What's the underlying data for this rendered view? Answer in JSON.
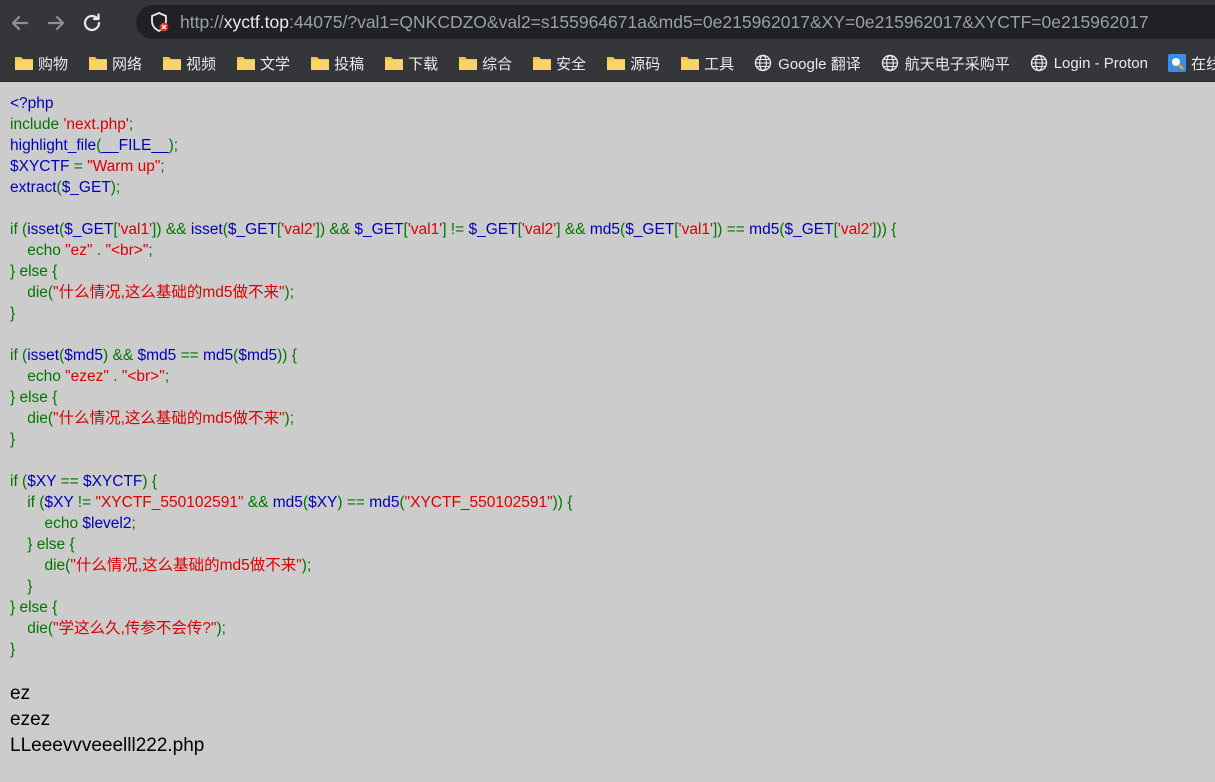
{
  "browser": {
    "url": {
      "scheme": "http://",
      "host": "xyctf.top",
      "rest": ":44075/?val1=QNKCDZO&val2=s155964671a&md5=0e215962017&XY=0e215962017&XYCTF=0e215962017"
    },
    "icons": {
      "back": "back-arrow-icon",
      "forward": "forward-arrow-icon",
      "reload": "reload-icon",
      "security": "not-secure-shield-icon"
    },
    "colors": {
      "chrome": "#35363a",
      "omnibox": "#202124",
      "folder": "#f6c343"
    }
  },
  "bookmarks": [
    {
      "label": "购物",
      "icon": "folder-icon"
    },
    {
      "label": "网络",
      "icon": "folder-icon"
    },
    {
      "label": "视频",
      "icon": "folder-icon"
    },
    {
      "label": "文学",
      "icon": "folder-icon"
    },
    {
      "label": "投稿",
      "icon": "folder-icon"
    },
    {
      "label": "下载",
      "icon": "folder-icon"
    },
    {
      "label": "综合",
      "icon": "folder-icon"
    },
    {
      "label": "安全",
      "icon": "folder-icon"
    },
    {
      "label": "源码",
      "icon": "folder-icon"
    },
    {
      "label": "工具",
      "icon": "folder-icon"
    },
    {
      "label": "Google 翻译",
      "icon": "globe-icon"
    },
    {
      "label": "航天电子采购平",
      "icon": "globe-icon"
    },
    {
      "label": "Login - Proton",
      "icon": "globe-icon"
    },
    {
      "label": "在线翻译",
      "icon": "translate-favicon-icon"
    }
  ],
  "code_lines": [
    [
      [
        "d",
        "<?php"
      ]
    ],
    [
      [
        "k",
        "include "
      ],
      [
        "s",
        "'next.php'"
      ],
      [
        "k",
        ";"
      ]
    ],
    [
      [
        "d",
        "highlight_file"
      ],
      [
        "k",
        "("
      ],
      [
        "d",
        "__FILE__"
      ],
      [
        "k",
        ");"
      ]
    ],
    [
      [
        "d",
        "$XYCTF "
      ],
      [
        "k",
        "= "
      ],
      [
        "s",
        "\"Warm up\""
      ],
      [
        "k",
        ";"
      ]
    ],
    [
      [
        "d",
        "extract"
      ],
      [
        "k",
        "("
      ],
      [
        "d",
        "$_GET"
      ],
      [
        "k",
        ");"
      ]
    ],
    [],
    [
      [
        "k",
        "if ("
      ],
      [
        "d",
        "isset"
      ],
      [
        "k",
        "("
      ],
      [
        "d",
        "$_GET"
      ],
      [
        "k",
        "["
      ],
      [
        "s",
        "'val1'"
      ],
      [
        "k",
        "]) && "
      ],
      [
        "d",
        "isset"
      ],
      [
        "k",
        "("
      ],
      [
        "d",
        "$_GET"
      ],
      [
        "k",
        "["
      ],
      [
        "s",
        "'val2'"
      ],
      [
        "k",
        "]) && "
      ],
      [
        "d",
        "$_GET"
      ],
      [
        "k",
        "["
      ],
      [
        "s",
        "'val1'"
      ],
      [
        "k",
        "] != "
      ],
      [
        "d",
        "$_GET"
      ],
      [
        "k",
        "["
      ],
      [
        "s",
        "'val2'"
      ],
      [
        "k",
        "] && "
      ],
      [
        "d",
        "md5"
      ],
      [
        "k",
        "("
      ],
      [
        "d",
        "$_GET"
      ],
      [
        "k",
        "["
      ],
      [
        "s",
        "'val1'"
      ],
      [
        "k",
        "]) == "
      ],
      [
        "d",
        "md5"
      ],
      [
        "k",
        "("
      ],
      [
        "d",
        "$_GET"
      ],
      [
        "k",
        "["
      ],
      [
        "s",
        "'val2'"
      ],
      [
        "k",
        "])) {"
      ]
    ],
    [
      [
        "k",
        "    echo "
      ],
      [
        "s",
        "\"ez\" "
      ],
      [
        "k",
        ". "
      ],
      [
        "s",
        "\"<br>\""
      ],
      [
        "k",
        ";"
      ]
    ],
    [
      [
        "k",
        "} else {"
      ]
    ],
    [
      [
        "k",
        "    die("
      ],
      [
        "s",
        "\"什么情况,这么基础的md5做不来\""
      ],
      [
        "k",
        ");"
      ]
    ],
    [
      [
        "k",
        "}"
      ]
    ],
    [],
    [
      [
        "k",
        "if ("
      ],
      [
        "d",
        "isset"
      ],
      [
        "k",
        "("
      ],
      [
        "d",
        "$md5"
      ],
      [
        "k",
        ") && "
      ],
      [
        "d",
        "$md5 "
      ],
      [
        "k",
        "== "
      ],
      [
        "d",
        "md5"
      ],
      [
        "k",
        "("
      ],
      [
        "d",
        "$md5"
      ],
      [
        "k",
        ")) {"
      ]
    ],
    [
      [
        "k",
        "    echo "
      ],
      [
        "s",
        "\"ezez\" "
      ],
      [
        "k",
        ". "
      ],
      [
        "s",
        "\"<br>\""
      ],
      [
        "k",
        ";"
      ]
    ],
    [
      [
        "k",
        "} else {"
      ]
    ],
    [
      [
        "k",
        "    die("
      ],
      [
        "s",
        "\"什么情况,这么基础的md5做不来\""
      ],
      [
        "k",
        ");"
      ]
    ],
    [
      [
        "k",
        "}"
      ]
    ],
    [],
    [
      [
        "k",
        "if ("
      ],
      [
        "d",
        "$XY "
      ],
      [
        "k",
        "== "
      ],
      [
        "d",
        "$XYCTF"
      ],
      [
        "k",
        ") {"
      ]
    ],
    [
      [
        "k",
        "    if ("
      ],
      [
        "d",
        "$XY "
      ],
      [
        "k",
        "!= "
      ],
      [
        "s",
        "\"XYCTF_550102591\" "
      ],
      [
        "k",
        "&& "
      ],
      [
        "d",
        "md5"
      ],
      [
        "k",
        "("
      ],
      [
        "d",
        "$XY"
      ],
      [
        "k",
        ") == "
      ],
      [
        "d",
        "md5"
      ],
      [
        "k",
        "("
      ],
      [
        "s",
        "\"XYCTF_550102591\""
      ],
      [
        "k",
        ")) {"
      ]
    ],
    [
      [
        "k",
        "        echo "
      ],
      [
        "d",
        "$level2"
      ],
      [
        "k",
        ";"
      ]
    ],
    [
      [
        "k",
        "    } else {"
      ]
    ],
    [
      [
        "k",
        "        die("
      ],
      [
        "s",
        "\"什么情况,这么基础的md5做不来\""
      ],
      [
        "k",
        ");"
      ]
    ],
    [
      [
        "k",
        "    }"
      ]
    ],
    [
      [
        "k",
        "} else {"
      ]
    ],
    [
      [
        "k",
        "    die("
      ],
      [
        "s",
        "\"学这么久,传参不会传?\""
      ],
      [
        "k",
        ");"
      ]
    ],
    [
      [
        "k",
        "}"
      ]
    ]
  ],
  "highlight_colors": {
    "k": "#007700",
    "d": "#0000bb",
    "s": "#dd0000"
  },
  "output": {
    "line1": "ez",
    "line2": "ezez",
    "line3": "LLeeevvveeelll222.php"
  }
}
